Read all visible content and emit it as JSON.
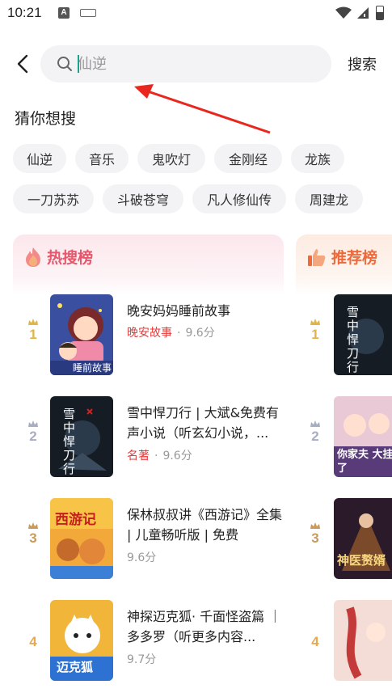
{
  "status_bar": {
    "time": "10:21",
    "notification_icon_letter": "A",
    "icons": [
      "keyboard-icon",
      "wifi-icon",
      "signal-icon",
      "battery-icon"
    ]
  },
  "search": {
    "back_icon": "back-arrow-icon",
    "search_icon": "search-icon",
    "placeholder": "仙逆",
    "value": "",
    "button_label": "搜索"
  },
  "guess": {
    "title": "猜你想搜",
    "row1": [
      "仙逆",
      "音乐",
      "鬼吹灯",
      "金刚经",
      "龙族"
    ],
    "row2": [
      "一刀苏苏",
      "斗破苍穹",
      "凡人修仙传",
      "周建龙"
    ]
  },
  "hot_list": {
    "title": "热搜榜",
    "icon": "flame-icon",
    "items": [
      {
        "rank": "1",
        "title": "晚安妈妈睡前故事",
        "tag": "晚安故事",
        "score": "9.6分",
        "cover_text": "睡前故事"
      },
      {
        "rank": "2",
        "title": "雪中悍刀行 | 大斌&免费有声小说（听玄幻小说，...",
        "tag": "名著",
        "score": "9.6分",
        "cover_text": "雪中悍刀行"
      },
      {
        "rank": "3",
        "title": "保林叔叔讲《西游记》全集 | 儿童畅听版 | 免费",
        "tag": "",
        "score": "9.6分",
        "cover_text": "西游记"
      },
      {
        "rank": "4",
        "title": "神探迈克狐· 千面怪盗篇 ｜ 多多罗（听更多内容...",
        "tag": "",
        "score": "9.7分",
        "cover_text": "迈克狐"
      }
    ]
  },
  "recommend_list": {
    "title": "推荐榜",
    "icon": "thumbs-up-icon",
    "items": [
      {
        "rank": "1",
        "cover_text": "雪中悍刀行"
      },
      {
        "rank": "2",
        "cover_text": "你家夫 大挂了"
      },
      {
        "rank": "3",
        "cover_text": "神医赘婿"
      },
      {
        "rank": "4",
        "cover_text": ""
      }
    ]
  },
  "colors": {
    "hot_accent": "#e9566c",
    "rec_accent": "#ee6a3a",
    "tag_red": "#e23a3a",
    "rank1": "#e0b64a",
    "rank2": "#a9adc2",
    "rank3": "#c99a5c",
    "rank4": "#e7a84e",
    "annotation_arrow": "#e8281e"
  }
}
